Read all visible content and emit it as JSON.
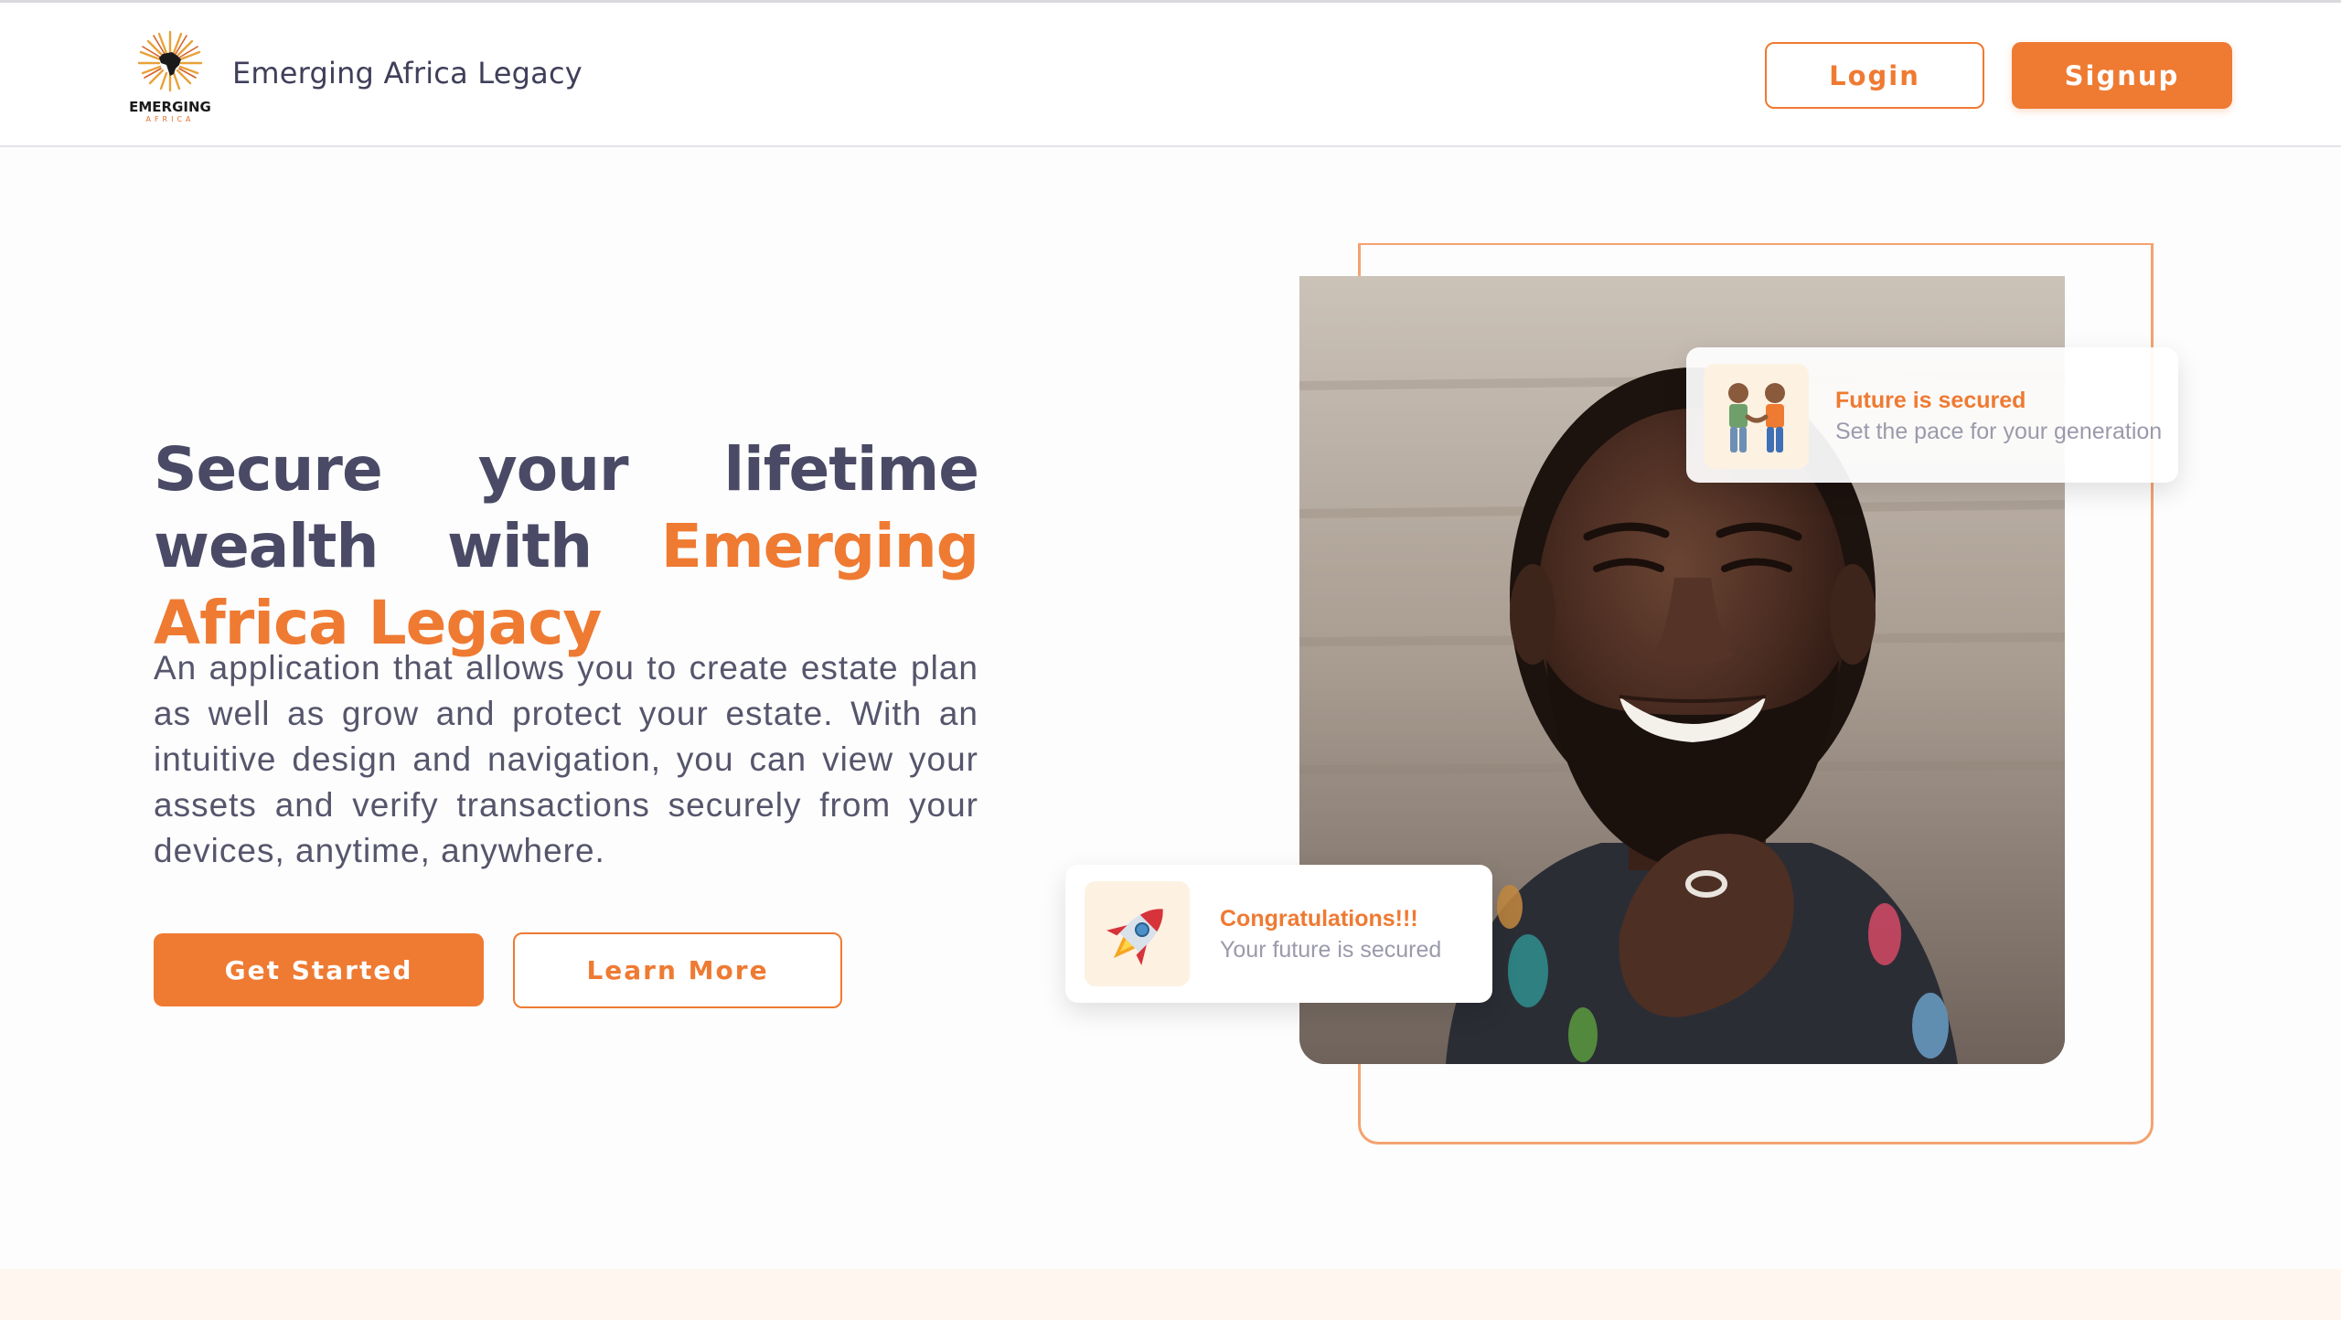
{
  "header": {
    "brand_name": "Emerging Africa Legacy",
    "logo_text_top": "EMERGING",
    "logo_text_bottom": "AFRICA",
    "login_label": "Login",
    "signup_label": "Signup"
  },
  "hero": {
    "title_part1": "Secure your lifetime wealth with ",
    "title_accent": "Emerging Africa Legacy",
    "description": "An application that allows you to create estate plan as well as grow and protect your estate. With an intuitive design and navigation, you can view your assets and verify transactions securely from your devices, anytime, anywhere.",
    "get_started_label": "Get Started",
    "learn_more_label": "Learn More"
  },
  "cards": {
    "top": {
      "title": "Future is secured",
      "subtitle": "Set the pace for your generation",
      "icon": "two-people-holding-hands-icon"
    },
    "bottom": {
      "title": "Congratulations!!!",
      "subtitle": "Your future is secured",
      "icon": "rocket-icon"
    }
  },
  "colors": {
    "accent": "#ef7a32",
    "text": "#4a4a66",
    "muted": "#9a9aab",
    "background": "#fdfdfd"
  }
}
